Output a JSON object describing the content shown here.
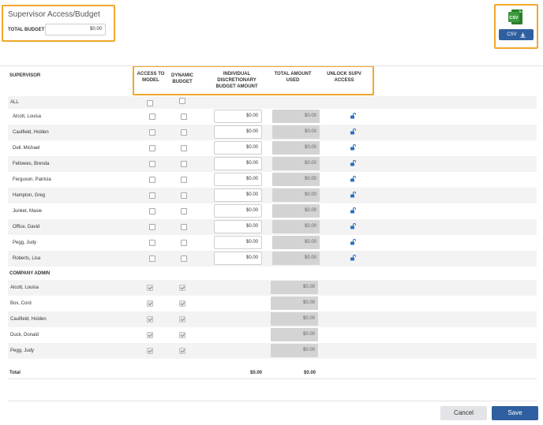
{
  "title": "Supervisor Access/Budget",
  "total_budget": {
    "label": "TOTAL BUDGET",
    "value": "$0.00"
  },
  "export": {
    "icon_text": "CSV",
    "button_label": "CSV",
    "icon_name": "download-icon"
  },
  "columns": {
    "supervisor": "SUPERVISOR",
    "access_to_model": "ACCESS TO MODEL",
    "dynamic_budget": "DYNAMIC BUDGET",
    "individual_budget": "INDIVIDUAL DISCRETIONARY BUDGET AMOUNT",
    "total_used": "TOTAL AMOUNT USED",
    "unlock": "UNLOCK SUPV ACCESS"
  },
  "all_label": "ALL",
  "supervisors": [
    {
      "name": "Alcott, Louisa",
      "budget": "$0.00",
      "used": "$0.00"
    },
    {
      "name": "Caulfield, Holden",
      "budget": "$0.00",
      "used": "$0.00"
    },
    {
      "name": "Dell, Michael",
      "budget": "$0.00",
      "used": "$0.00"
    },
    {
      "name": "Fellowes, Brenda",
      "budget": "$0.00",
      "used": "$0.00"
    },
    {
      "name": "Ferguson, Patricia",
      "budget": "$0.00",
      "used": "$0.00"
    },
    {
      "name": "Hampton, Greg",
      "budget": "$0.00",
      "used": "$0.00"
    },
    {
      "name": "Junket, Masie",
      "budget": "$0.00",
      "used": "$0.00"
    },
    {
      "name": "Office, David",
      "budget": "$0.00",
      "used": "$0.00"
    },
    {
      "name": "Pegg, Judy",
      "budget": "$0.00",
      "used": "$0.00"
    },
    {
      "name": "Roberts, Lisa",
      "budget": "$0.00",
      "used": "$0.00"
    }
  ],
  "company_admin_label": "COMPANY ADMIN",
  "admins": [
    {
      "name": "Alcott, Louisa",
      "used": "$0.00"
    },
    {
      "name": "Box, Cord",
      "used": "$0.00"
    },
    {
      "name": "Caulfield, Holden",
      "used": "$0.00"
    },
    {
      "name": "Duck, Donald",
      "used": "$0.00"
    },
    {
      "name": "Pegg, Judy",
      "used": "$0.00"
    }
  ],
  "totals": {
    "label": "Total",
    "budget": "$0.00",
    "used": "$0.00"
  },
  "buttons": {
    "cancel": "Cancel",
    "save": "Save"
  },
  "colors": {
    "highlight": "#f2a72c",
    "primary": "#2f5fa0",
    "csv_green": "#3c9a3c"
  }
}
